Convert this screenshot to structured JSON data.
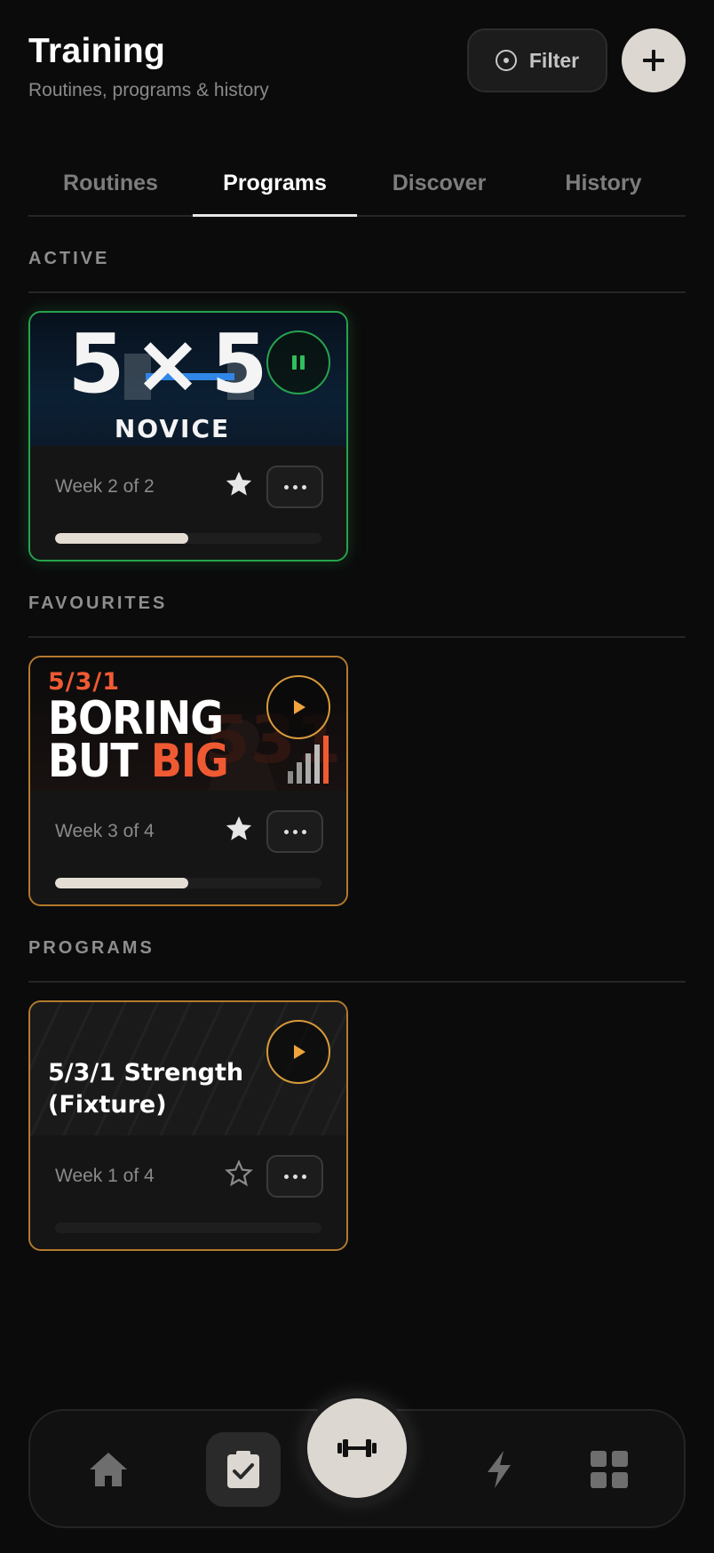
{
  "header": {
    "title": "Training",
    "subtitle": "Routines, programs & history"
  },
  "toolbar": {
    "filter_label": "Filter",
    "filter_icon": "target-icon",
    "add_icon": "plus-icon"
  },
  "tabs": [
    {
      "label": "Routines",
      "active": false
    },
    {
      "label": "Programs",
      "active": true
    },
    {
      "label": "Discover",
      "active": false
    },
    {
      "label": "History",
      "active": false
    }
  ],
  "sections": {
    "active": "ACTIVE",
    "favourites": "FAVOURITES",
    "programs": "PROGRAMS"
  },
  "cards": [
    {
      "banner_main": "5×5",
      "banner_sub": "NOVICE",
      "week": "Week 2 of 2",
      "progress": 0.5,
      "favourite": true,
      "state": "pause",
      "border_color": "#27a24e"
    },
    {
      "banner_top": "5/3/1",
      "banner_line1": "BORING",
      "banner_line2a": "BUT ",
      "banner_line2b": "BIG",
      "week": "Week 3 of 4",
      "progress": 0.5,
      "favourite": true,
      "state": "play",
      "border_color": "#b37a2d"
    },
    {
      "title": "5/3/1 Strength (Fixture)",
      "week": "Week 1 of 4",
      "progress": 0.0,
      "favourite": false,
      "state": "play",
      "border_color": "#b37a2d"
    }
  ],
  "bottom_nav": {
    "items": [
      "home-icon",
      "checklist-icon",
      "dumbbell-icon",
      "lightning-icon",
      "grid-icon"
    ],
    "selected": "checklist-icon"
  },
  "colors": {
    "accent_green": "#27a24e",
    "accent_orange": "#d79a3a",
    "accent_red": "#f05a33",
    "accent_blue": "#2f86e6",
    "light": "#dcd7d1"
  }
}
